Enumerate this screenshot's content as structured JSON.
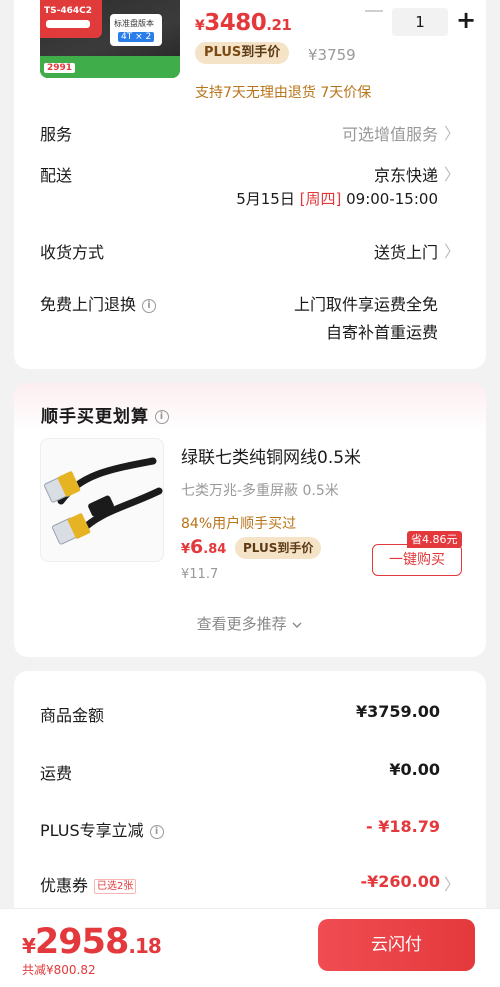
{
  "product": {
    "thumb_badge": "TS-464C2",
    "thumb_price": "2991",
    "thumb_box": "4T × 2",
    "thumb_badge2": "标准盘版本",
    "price_symbol": "¥",
    "price_int": "3480",
    "price_dec": ".21",
    "plus_label": "PLUS",
    "plus_text": "到手价",
    "original_price": "¥3759",
    "quantity": "1",
    "refund_note": "支持7天无理由退货  7天价保"
  },
  "rows": {
    "service": {
      "label": "服务",
      "value": "可选增值服务"
    },
    "delivery": {
      "label": "配送",
      "value": "京东快递",
      "date": "5月15日",
      "weekday": "[周四]",
      "time": "09:00-15:00"
    },
    "receive": {
      "label": "收货方式",
      "value": "送货上门"
    },
    "free_return": {
      "label": "免费上门退换",
      "line1": "上门取件享运费全免",
      "line2": "自寄补首重运费"
    }
  },
  "recommend": {
    "title": "顺手买更划算",
    "name": "绿联七类纯铜网线0.5米",
    "spec": "七类万兆-多重屏蔽   0.5米",
    "percent": "84%用户顺手买过",
    "price_symbol": "¥",
    "price_int": "6",
    "price_dec": ".84",
    "plus_label": "PLUS",
    "plus_text": "到手价",
    "original_price": "¥11.7",
    "save_tag": "省4.86元",
    "buy_button": "一键购买",
    "more": "查看更多推荐"
  },
  "summary": {
    "goods_amount": {
      "label": "商品金额",
      "value": "¥3759.00"
    },
    "shipping": {
      "label": "运费",
      "value": "¥0.00"
    },
    "plus_discount": {
      "label": "PLUS专享立减",
      "value": "- ¥18.79"
    },
    "coupon": {
      "label": "优惠券",
      "tag": "已选2张",
      "value": "-¥260.00"
    }
  },
  "footer": {
    "total_symbol": "¥",
    "total_int": "2958",
    "total_dec": ".18",
    "total_saved": "共减¥800.82",
    "pay_button": "云闪付"
  },
  "colors": {
    "accent_red": "#e4393c",
    "plus_tag_bg": "#f5e3c8",
    "orange_text": "#b8741a"
  },
  "icons": [
    "info-icon",
    "chevron-right-icon",
    "chevron-down-icon",
    "minus-icon",
    "plus-icon"
  ]
}
